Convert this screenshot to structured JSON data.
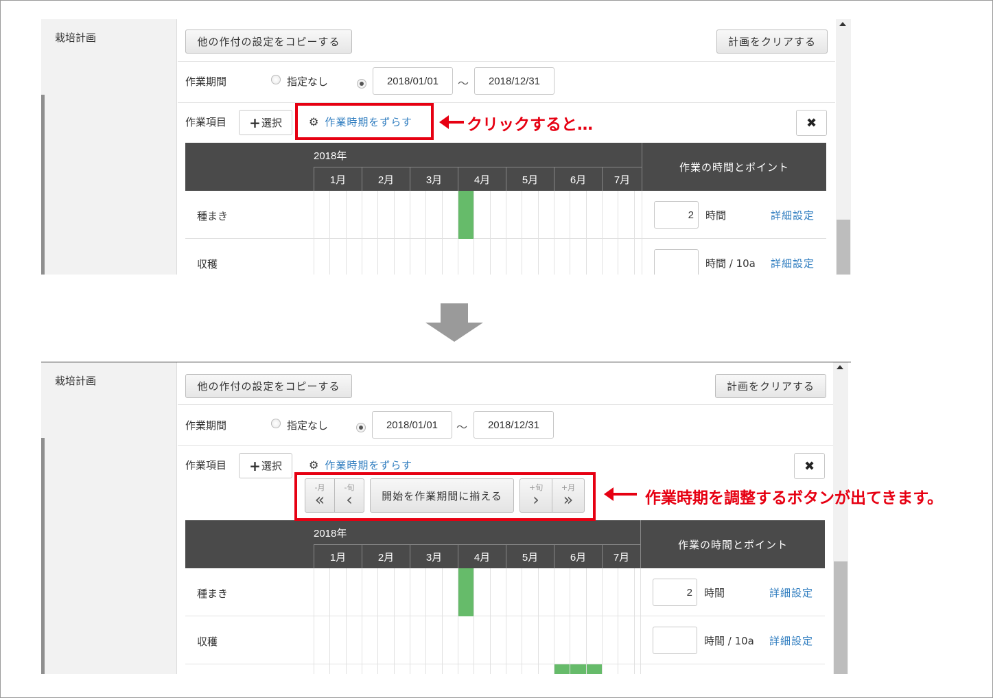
{
  "sidebar": {
    "section_label": "栽培計画"
  },
  "toolbar": {
    "copy_button": "他の作付の設定をコピーする",
    "clear_button": "計画をクリアする"
  },
  "period": {
    "label": "作業期間",
    "none_option": "指定なし",
    "start_date": "2018/01/01",
    "separator": "〜",
    "end_date": "2018/12/31"
  },
  "work_items": {
    "label": "作業項目",
    "select_button": "選択",
    "shift_link": "作業時期をずらす",
    "gear_icon": "gear-icon"
  },
  "shift_controls": {
    "prev_month_small": "-月",
    "prev_decade_small": "-旬",
    "align_button": "開始を作業期間に揃える",
    "next_decade_small": "+旬",
    "next_month_small": "+月",
    "prev_month_glyph": "«",
    "prev_decade_glyph": "‹",
    "next_decade_glyph": "›",
    "next_month_glyph": "»"
  },
  "table": {
    "year": "2018年",
    "months": [
      "1月",
      "2月",
      "3月",
      "4月",
      "5月",
      "6月",
      "7月"
    ],
    "points_header": "作業の時間とポイント",
    "rows": [
      {
        "label": "種まき",
        "hours": "2",
        "unit": "時間",
        "detail": "詳細設定"
      },
      {
        "label": "収穫",
        "hours": "",
        "unit": "時間 / 10a",
        "detail": "詳細設定"
      }
    ]
  },
  "annotations": {
    "first": "クリックすると…",
    "second": "作業時期を調整するボタンが出てきます。"
  },
  "colors": {
    "accent_red": "#e60012",
    "link_blue": "#2e7cbf",
    "active_cell_green": "#66bb6a",
    "header_dark": "#4a4a4a"
  }
}
